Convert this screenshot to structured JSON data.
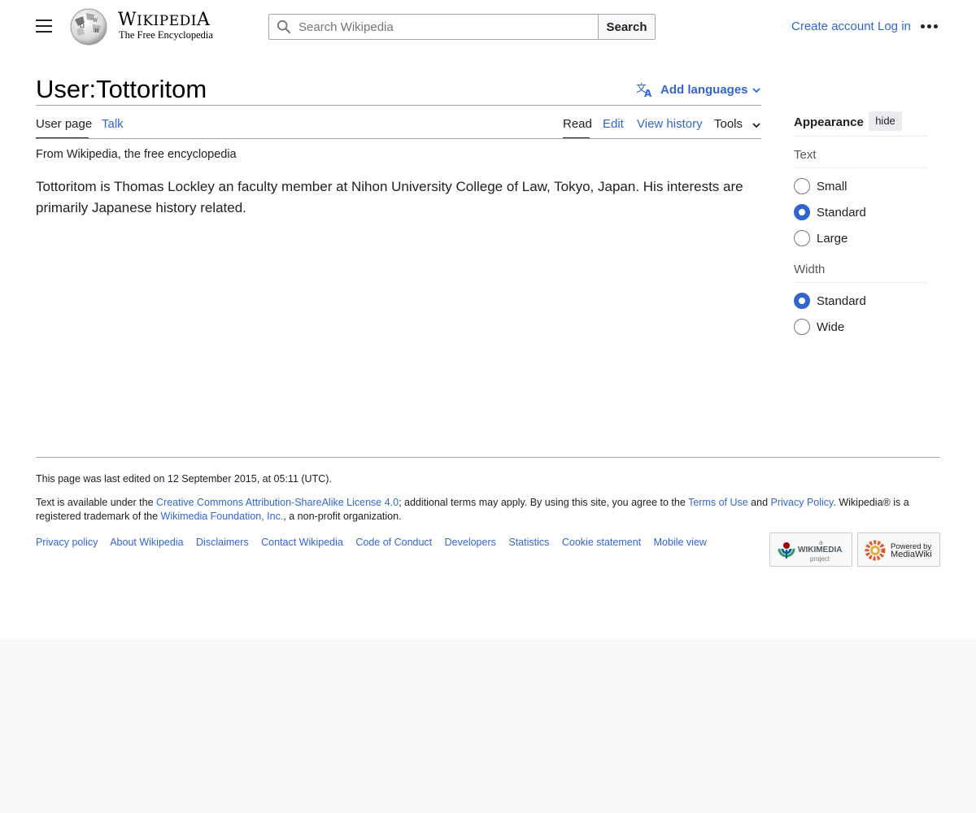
{
  "header": {
    "wordmark": "Wikipedia",
    "wordmark_first": "W",
    "wordmark_rest": "IKIPEDI",
    "wordmark_last": "A",
    "tagline": "The Free Encyclopedia",
    "search_placeholder": "Search Wikipedia",
    "search_button": "Search",
    "create_account": "Create account",
    "log_in": "Log in"
  },
  "page": {
    "title": "User:Tottoritom",
    "add_languages": "Add languages",
    "tabs_left": [
      "User page",
      "Talk"
    ],
    "tabs_right": [
      "Read",
      "Edit",
      "View history",
      "Tools"
    ],
    "from_line": "From Wikipedia, the free encyclopedia",
    "body": "Tottoritom is Thomas Lockley an faculty member at Nihon University College of Law, Tokyo, Japan. His interests are primarily Japanese history related."
  },
  "appearance": {
    "title": "Appearance",
    "hide": "hide",
    "text_label": "Text",
    "text_options": [
      "Small",
      "Standard",
      "Large"
    ],
    "text_selected": "Standard",
    "width_label": "Width",
    "width_options": [
      "Standard",
      "Wide"
    ],
    "width_selected": "Standard"
  },
  "footer": {
    "last_edited": "This page was last edited on 12 September 2015, at 05:11 (UTC).",
    "license_1": "Text is available under the ",
    "license_link": "Creative Commons Attribution-ShareAlike License 4.0",
    "license_2": "; additional terms may apply. By using this site, you agree to the ",
    "terms_link": "Terms of Use",
    "license_3": " and ",
    "privacy_link": "Privacy Policy",
    "license_4": ". Wikipedia® is a registered trademark of the ",
    "wmf_link": "Wikimedia Foundation, Inc.",
    "license_5": ", a non-profit organization.",
    "links": [
      "Privacy policy",
      "About Wikipedia",
      "Disclaimers",
      "Contact Wikipedia",
      "Code of Conduct",
      "Developers",
      "Statistics",
      "Cookie statement",
      "Mobile view"
    ],
    "badge_wikimedia": [
      "a",
      "WIKIMEDIA",
      "project"
    ],
    "badge_mediawiki": [
      "Powered by",
      "MediaWiki"
    ]
  },
  "colors": {
    "link": "#3366cc",
    "text": "#202122",
    "border": "#a2a9b1",
    "footer_bg": "#f8f9fa"
  },
  "icons": [
    "menu-icon",
    "wikipedia-globe-logo",
    "search-icon",
    "more-dots-icon",
    "translate-icon",
    "chevron-down-icon"
  ]
}
